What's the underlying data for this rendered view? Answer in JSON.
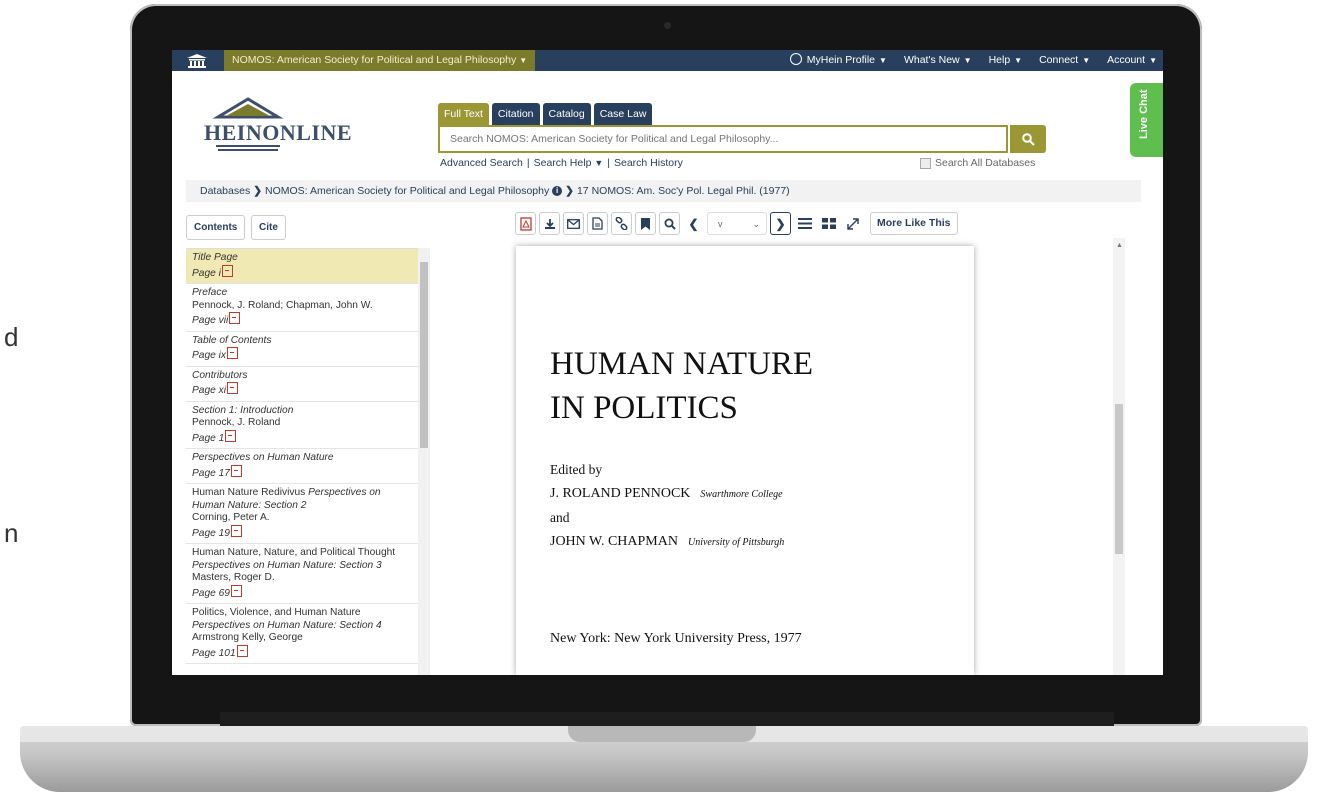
{
  "edge_text": [
    "d",
    "n"
  ],
  "topbar": {
    "database": "NOMOS: American Society for Political and Legal Philosophy",
    "nav": [
      "MyHein Profile",
      "What's New",
      "Help",
      "Connect",
      "Account"
    ]
  },
  "logo": {
    "text": "HEINONLINE"
  },
  "search": {
    "tabs": [
      "Full Text",
      "Citation",
      "Catalog",
      "Case Law"
    ],
    "placeholder": "Search NOMOS: American Society for Political and Legal Philosophy...",
    "links": [
      "Advanced Search",
      "Search Help",
      "Search History"
    ],
    "search_all_label": "Search All Databases"
  },
  "live_chat": "Live Chat",
  "breadcrumb": {
    "root": "Databases",
    "collection": "NOMOS: American Society for Political and Legal Philosophy",
    "volume": "17 NOMOS: Am. Soc'y Pol. Legal Phil. (1977)"
  },
  "sidebar": {
    "contents_button": "Contents",
    "cite_button": "Cite",
    "items": [
      {
        "title": "Title Page",
        "author": "",
        "page": "Page i",
        "italic": true
      },
      {
        "title": "Preface",
        "author": "Pennock, J. Roland; Chapman, John W.",
        "page": "Page vii",
        "italic": true
      },
      {
        "title": "Table of Contents",
        "author": "",
        "page": "Page ix",
        "italic": true
      },
      {
        "title": "Contributors",
        "author": "",
        "page": "Page xi",
        "italic": true
      },
      {
        "title": "Section 1: Introduction",
        "author": "Pennock, J. Roland",
        "page": "Page 1",
        "italic": true
      },
      {
        "title": "Perspectives on Human Nature",
        "author": "",
        "page": "Page 17",
        "italic": true
      },
      {
        "title": "Human Nature Redivivus",
        "subtitle": "Perspectives on Human Nature: Section 2",
        "author": "Corning, Peter A.",
        "page": "Page 19",
        "italic": false
      },
      {
        "title": "Human Nature, Nature, and Political Thought",
        "subtitle": "Perspectives on Human Nature: Section 3",
        "author": "Masters, Roger D.",
        "page": "Page 69",
        "italic": false
      },
      {
        "title": "Politics, Violence, and Human Nature",
        "subtitle": "Perspectives on Human Nature: Section 4",
        "author": "Armstrong Kelly, George",
        "page": "Page 101",
        "italic": false
      }
    ]
  },
  "toolbar": {
    "page_value": "v",
    "more_like_this": "More Like This"
  },
  "document": {
    "title_line1": "HUMAN NATURE",
    "title_line2": "IN POLITICS",
    "edited_by": "Edited by",
    "editor1": "J. ROLAND PENNOCK",
    "editor1_affiliation": "Swarthmore College",
    "and": "and",
    "editor2": "JOHN W. CHAPMAN",
    "editor2_affiliation": "University of Pittsburgh",
    "publisher": "New York: New York University Press, 1977"
  }
}
